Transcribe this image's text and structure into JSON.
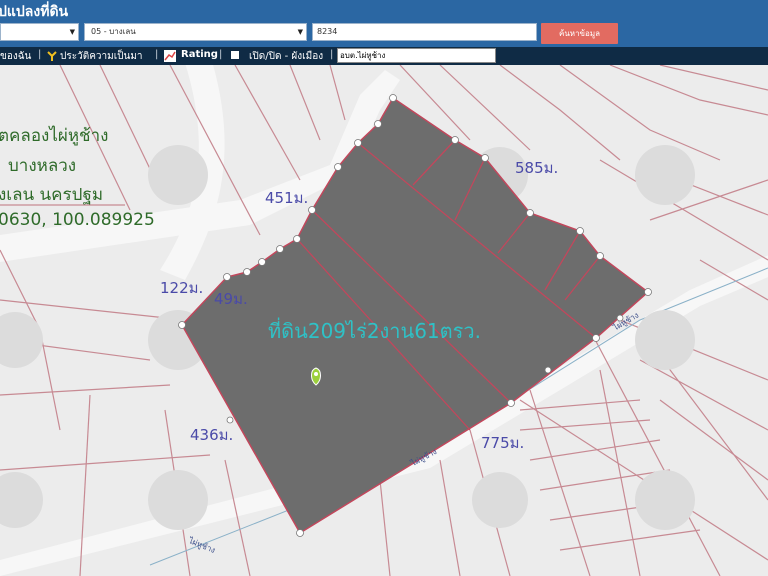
{
  "app": {
    "title": "ปแปลงที่ดิน"
  },
  "search": {
    "province_value": "",
    "district_value": "05 - บางเลน",
    "parcel_value": "8234",
    "search_button_label": "ค้นหาข้อมูล"
  },
  "toolbar": {
    "items": [
      "ของฉัน",
      "ประวัติความเป็นมา",
      "Rating",
      "เปิด/ปิด - ผังเมือง"
    ],
    "input_value": "อบต.ไผ่หูช้าง"
  },
  "info": {
    "line1": "ตคลองไผ่หูช้าง",
    "line2": "บางหลวง",
    "line3": "งเลน นครปฐม",
    "line4": "0630, 100.089925"
  },
  "dimensions": {
    "top_edge": "451ม.",
    "right_edge": "585ม.",
    "left_small": "122ม.",
    "left_notch": "49ม.",
    "left_edge": "436ม.",
    "bottom_edge": "775ม."
  },
  "parcel": {
    "area_label": "ที่ดิน209ไร่2งาน61ตรว."
  },
  "roads": {
    "road_a": "ไผ่หูช้าง",
    "road_b": "ไผ่หูช้าง",
    "road_c": "ไผ่หูช้าง"
  },
  "colors": {
    "parcel_fill": "#6d6d6d",
    "parcel_border": "#c2475c",
    "header_bg": "#2b67a3",
    "toolbar_bg": "#0f2b45",
    "search_button": "#e26b61"
  },
  "icons": {
    "map_pin": "map-pin-icon",
    "seal": "seal-watermark-icon"
  }
}
